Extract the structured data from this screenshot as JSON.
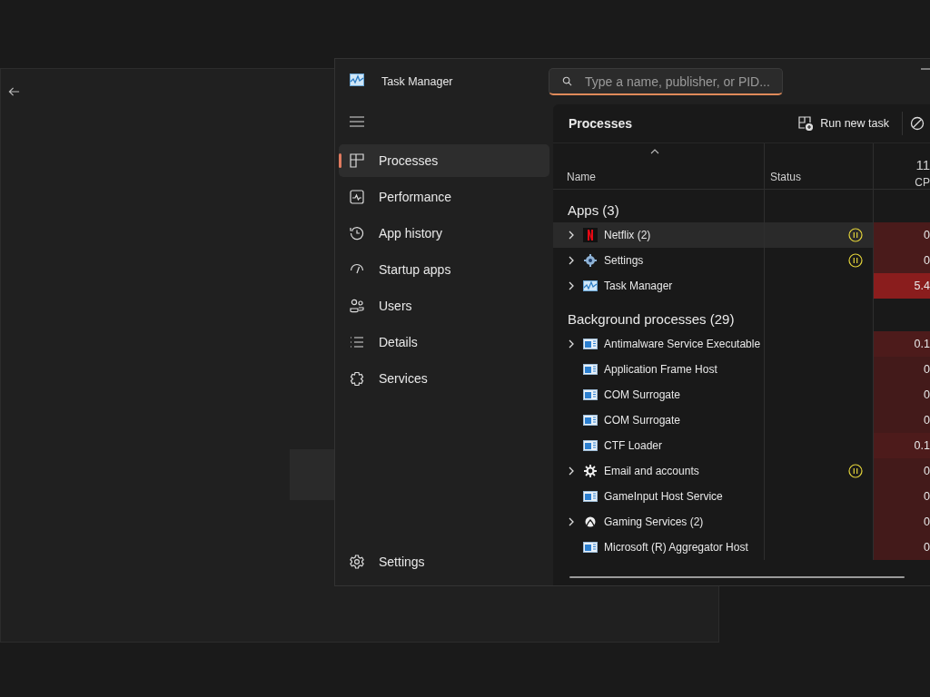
{
  "window": {
    "title": "Task Manager",
    "search": {
      "placeholder": "Type a name, publisher, or PID..."
    }
  },
  "sidebar": {
    "items": [
      {
        "label": "Processes",
        "kind": "processes",
        "selected": true
      },
      {
        "label": "Performance",
        "kind": "performance",
        "selected": false
      },
      {
        "label": "App history",
        "kind": "history",
        "selected": false
      },
      {
        "label": "Startup apps",
        "kind": "startup",
        "selected": false
      },
      {
        "label": "Users",
        "kind": "users",
        "selected": false
      },
      {
        "label": "Details",
        "kind": "details",
        "selected": false
      },
      {
        "label": "Services",
        "kind": "services",
        "selected": false
      }
    ],
    "footer": {
      "label": "Settings"
    }
  },
  "toolbar": {
    "title": "Processes",
    "run_new_task": "Run new task"
  },
  "table": {
    "columns": [
      {
        "label": "Name"
      },
      {
        "label": "Status"
      },
      {
        "label": "CP",
        "summary": "11"
      }
    ],
    "groups": [
      {
        "title": "Apps (3)",
        "rows": [
          {
            "name": "Netflix (2)",
            "kind": "netflix",
            "expandable": true,
            "suspended": true,
            "selected": true,
            "cpu": "0",
            "color": "#4a1b1b"
          },
          {
            "name": "Settings",
            "kind": "settings",
            "expandable": true,
            "suspended": true,
            "selected": false,
            "cpu": "0",
            "color": "#4a1b1b"
          },
          {
            "name": "Task Manager",
            "kind": "taskmanager",
            "expandable": true,
            "suspended": false,
            "selected": false,
            "cpu": "5.4",
            "color": "#8a1d1d"
          }
        ]
      },
      {
        "title": "Background processes (29)",
        "rows": [
          {
            "name": "Antimalware Service Executable",
            "kind": "service",
            "expandable": true,
            "suspended": false,
            "selected": false,
            "cpu": "0.1",
            "color": "#4d1b1b"
          },
          {
            "name": "Application Frame Host",
            "kind": "service",
            "expandable": false,
            "suspended": false,
            "selected": false,
            "cpu": "0",
            "color": "#431a1a"
          },
          {
            "name": "COM Surrogate",
            "kind": "service",
            "expandable": false,
            "suspended": false,
            "selected": false,
            "cpu": "0",
            "color": "#431a1a"
          },
          {
            "name": "COM Surrogate",
            "kind": "service",
            "expandable": false,
            "suspended": false,
            "selected": false,
            "cpu": "0",
            "color": "#431a1a"
          },
          {
            "name": "CTF Loader",
            "kind": "service",
            "expandable": false,
            "suspended": false,
            "selected": false,
            "cpu": "0.1",
            "color": "#4d1b1b"
          },
          {
            "name": "Email and accounts",
            "kind": "gear",
            "expandable": true,
            "suspended": true,
            "selected": false,
            "cpu": "0",
            "color": "#431a1a"
          },
          {
            "name": "GameInput Host Service",
            "kind": "service",
            "expandable": false,
            "suspended": false,
            "selected": false,
            "cpu": "0",
            "color": "#431a1a"
          },
          {
            "name": "Gaming Services (2)",
            "kind": "xbox",
            "expandable": true,
            "suspended": false,
            "selected": false,
            "cpu": "0",
            "color": "#431a1a"
          },
          {
            "name": "Microsoft (R) Aggregator Host",
            "kind": "service",
            "expandable": false,
            "suspended": false,
            "selected": false,
            "cpu": "0",
            "color": "#431a1a"
          }
        ]
      }
    ]
  }
}
